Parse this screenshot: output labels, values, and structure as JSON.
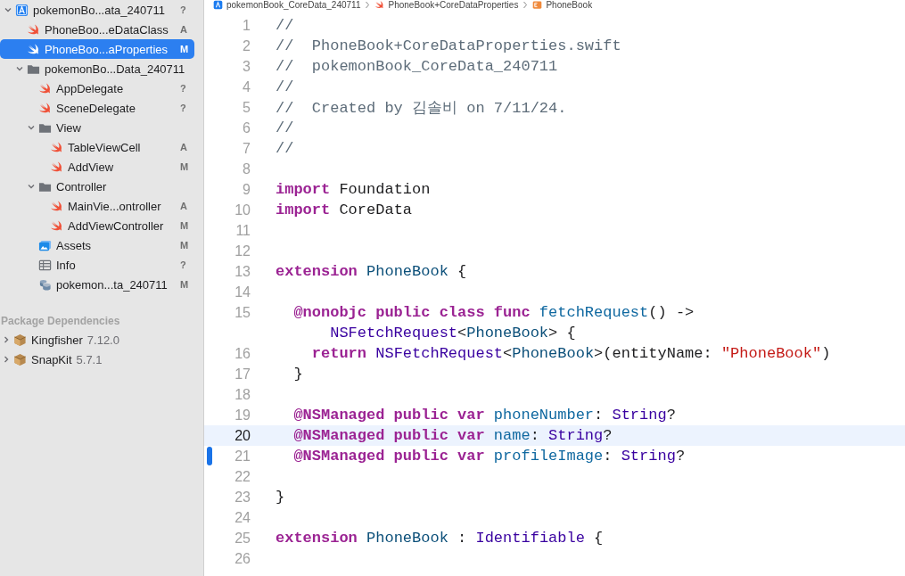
{
  "breadcrumb": [
    {
      "kind": "project",
      "label": "pokemonBook_CoreData_240711"
    },
    {
      "kind": "swift",
      "label": "PhoneBook+CoreDataProperties"
    },
    {
      "kind": "entity",
      "label": "PhoneBook"
    }
  ],
  "navigator": {
    "items": [
      {
        "name": "pokemonBo...ata_240711",
        "kind": "project",
        "badge": "?",
        "selected": false,
        "expanded": true,
        "children": [
          {
            "name": "PhoneBoo...eDataClass",
            "kind": "swift",
            "badge": "A",
            "selected": false
          },
          {
            "name": "PhoneBoo...aProperties",
            "kind": "swift",
            "badge": "M",
            "selected": true
          },
          {
            "name": "pokemonBo...Data_240711",
            "kind": "folder",
            "selected": false,
            "expanded": true,
            "children": [
              {
                "name": "AppDelegate",
                "kind": "swift",
                "badge": "?",
                "selected": false
              },
              {
                "name": "SceneDelegate",
                "kind": "swift",
                "badge": "?",
                "selected": false
              },
              {
                "name": "View",
                "kind": "folder",
                "selected": false,
                "expanded": true,
                "children": [
                  {
                    "name": "TableViewCell",
                    "kind": "swift",
                    "badge": "A",
                    "selected": false
                  },
                  {
                    "name": "AddView",
                    "kind": "swift",
                    "badge": "M",
                    "selected": false
                  }
                ]
              },
              {
                "name": "Controller",
                "kind": "folder",
                "selected": false,
                "expanded": true,
                "children": [
                  {
                    "name": "MainVie...ontroller",
                    "kind": "swift",
                    "badge": "A",
                    "selected": false
                  },
                  {
                    "name": "AddViewController",
                    "kind": "swift",
                    "badge": "M",
                    "selected": false
                  }
                ]
              },
              {
                "name": "Assets",
                "kind": "assets",
                "badge": "M",
                "selected": false
              },
              {
                "name": "Info",
                "kind": "plist",
                "badge": "?",
                "selected": false
              },
              {
                "name": "pokemon...ta_240711",
                "kind": "coredata",
                "badge": "M",
                "selected": false
              }
            ]
          }
        ]
      }
    ]
  },
  "packages": {
    "title": "Package Dependencies",
    "items": [
      {
        "name": "Kingfisher",
        "version": "7.12.0",
        "expanded": false
      },
      {
        "name": "SnapKit",
        "version": "5.7.1",
        "expanded": false
      }
    ]
  },
  "editor": {
    "lines": [
      {
        "number": "1",
        "selected": false,
        "changed": false,
        "tokens": [
          {
            "kind": "comment",
            "t": "//"
          }
        ]
      },
      {
        "number": "2",
        "selected": false,
        "changed": false,
        "tokens": [
          {
            "kind": "comment",
            "t": "//  PhoneBook+CoreDataProperties.swift"
          }
        ]
      },
      {
        "number": "3",
        "selected": false,
        "changed": false,
        "tokens": [
          {
            "kind": "comment",
            "t": "//  pokemonBook_CoreData_240711"
          }
        ]
      },
      {
        "number": "4",
        "selected": false,
        "changed": false,
        "tokens": [
          {
            "kind": "comment",
            "t": "//"
          }
        ]
      },
      {
        "number": "5",
        "selected": false,
        "changed": false,
        "tokens": [
          {
            "kind": "comment",
            "t": "//  Created by 김솔비 on 7/11/24."
          }
        ]
      },
      {
        "number": "6",
        "selected": false,
        "changed": false,
        "tokens": [
          {
            "kind": "comment",
            "t": "//"
          }
        ]
      },
      {
        "number": "7",
        "selected": false,
        "changed": false,
        "tokens": [
          {
            "kind": "comment",
            "t": "//"
          }
        ]
      },
      {
        "number": "8",
        "selected": false,
        "changed": false
      },
      {
        "number": "9",
        "selected": false,
        "changed": false,
        "tokens": [
          {
            "kind": "keyword",
            "t": "import"
          },
          {
            "kind": "plain",
            "t": " Foundation"
          }
        ]
      },
      {
        "number": "10",
        "selected": false,
        "changed": false,
        "tokens": [
          {
            "kind": "keyword",
            "t": "import"
          },
          {
            "kind": "plain",
            "t": " CoreData"
          }
        ]
      },
      {
        "number": "11",
        "selected": false,
        "changed": false
      },
      {
        "number": "12",
        "selected": false,
        "changed": false
      },
      {
        "number": "13",
        "selected": false,
        "changed": false,
        "tokens": [
          {
            "kind": "keyword",
            "t": "extension"
          },
          {
            "kind": "type",
            "t": " PhoneBook"
          },
          {
            "kind": "plain",
            "t": " {"
          }
        ]
      },
      {
        "number": "14",
        "selected": false,
        "changed": false
      },
      {
        "number": "15",
        "selected": false,
        "changed": false,
        "tokens": [
          {
            "kind": "keyword",
            "t": "  @nonobjc public class func"
          },
          {
            "kind": "decl",
            "t": " fetchRequest"
          },
          {
            "kind": "plain",
            "t": "() ->"
          }
        ],
        "wrap": [
          {
            "kind": "systype",
            "t": "      NSFetchRequest"
          },
          {
            "kind": "plain",
            "t": "<"
          },
          {
            "kind": "type",
            "t": "PhoneBook"
          },
          {
            "kind": "plain",
            "t": "> {"
          }
        ]
      },
      {
        "number": "16",
        "selected": false,
        "changed": false,
        "tokens": [
          {
            "kind": "keyword",
            "t": "    return"
          },
          {
            "kind": "systype",
            "t": " NSFetchRequest"
          },
          {
            "kind": "plain",
            "t": "<"
          },
          {
            "kind": "type",
            "t": "PhoneBook"
          },
          {
            "kind": "plain",
            "t": ">(entityName: "
          },
          {
            "kind": "string",
            "t": "\"PhoneBook\""
          },
          {
            "kind": "plain",
            "t": ")"
          }
        ]
      },
      {
        "number": "17",
        "selected": false,
        "changed": false,
        "tokens": [
          {
            "kind": "plain",
            "t": "  }"
          }
        ]
      },
      {
        "number": "18",
        "selected": false,
        "changed": false
      },
      {
        "number": "19",
        "selected": false,
        "changed": false,
        "tokens": [
          {
            "kind": "keyword",
            "t": "  @NSManaged public var"
          },
          {
            "kind": "decl",
            "t": " phoneNumber"
          },
          {
            "kind": "plain",
            "t": ": "
          },
          {
            "kind": "systype",
            "t": "String"
          },
          {
            "kind": "plain",
            "t": "?"
          }
        ]
      },
      {
        "number": "20",
        "selected": true,
        "changed": false,
        "tokens": [
          {
            "kind": "keyword",
            "t": "  @NSManaged public var"
          },
          {
            "kind": "decl",
            "t": " name"
          },
          {
            "kind": "plain",
            "t": ": "
          },
          {
            "kind": "systype",
            "t": "String"
          },
          {
            "kind": "plain",
            "t": "?"
          }
        ]
      },
      {
        "number": "21",
        "selected": false,
        "changed": true,
        "tokens": [
          {
            "kind": "keyword",
            "t": "  @NSManaged public var"
          },
          {
            "kind": "decl",
            "t": " profileImage"
          },
          {
            "kind": "plain",
            "t": ": "
          },
          {
            "kind": "systype",
            "t": "String"
          },
          {
            "kind": "plain",
            "t": "?"
          }
        ]
      },
      {
        "number": "22",
        "selected": false,
        "changed": false
      },
      {
        "number": "23",
        "selected": false,
        "changed": false,
        "tokens": [
          {
            "kind": "plain",
            "t": "}"
          }
        ]
      },
      {
        "number": "24",
        "selected": false,
        "changed": false
      },
      {
        "number": "25",
        "selected": false,
        "changed": false,
        "tokens": [
          {
            "kind": "keyword",
            "t": "extension"
          },
          {
            "kind": "type",
            "t": " PhoneBook"
          },
          {
            "kind": "plain",
            "t": " : "
          },
          {
            "kind": "systype",
            "t": "Identifiable"
          },
          {
            "kind": "plain",
            "t": " {"
          }
        ]
      },
      {
        "number": "26",
        "selected": false,
        "changed": false
      }
    ]
  }
}
